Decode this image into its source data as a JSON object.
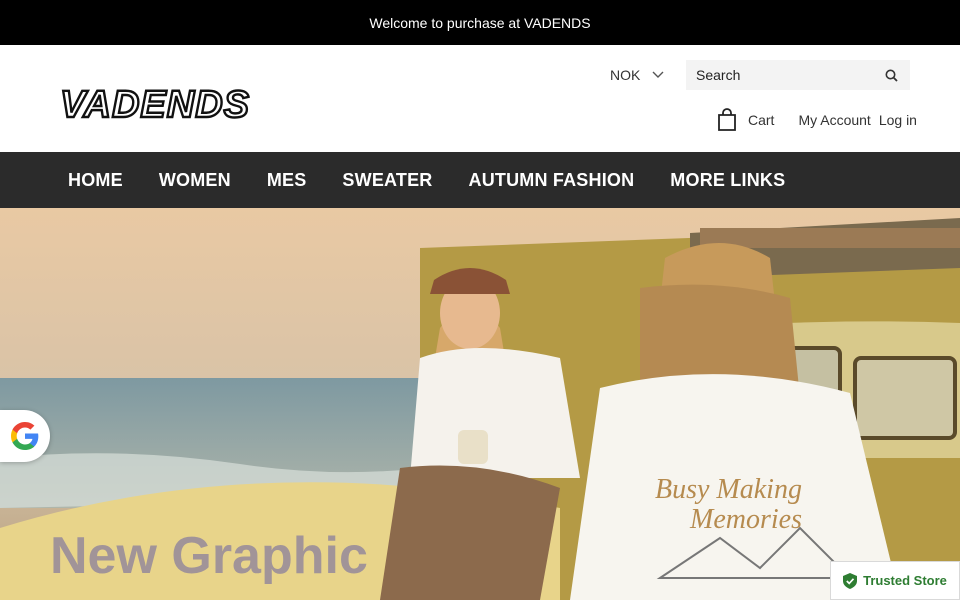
{
  "announcement": "Welcome to purchase at VADENDS",
  "brand": {
    "logo_text": "VADENDS"
  },
  "header": {
    "currency": "NOK",
    "search_placeholder": "Search",
    "cart_label": "Cart",
    "my_account_label": "My Account",
    "login_label": "Log in"
  },
  "nav": {
    "items": [
      {
        "label": "HOME"
      },
      {
        "label": "WOMEN"
      },
      {
        "label": "MES"
      },
      {
        "label": "SWEATER"
      },
      {
        "label": "AUTUMN FASHION"
      },
      {
        "label": "MORE LINKS"
      }
    ]
  },
  "hero": {
    "title": "New Graphic",
    "shirt_print": "Busy Making Memories"
  },
  "widgets": {
    "trusted_label": "Trusted Store",
    "google_icon": "google-g-icon"
  },
  "colors": {
    "announcement_bg": "#000000",
    "nav_bg": "#2b2b2b",
    "trusted_green": "#2e7d32"
  }
}
